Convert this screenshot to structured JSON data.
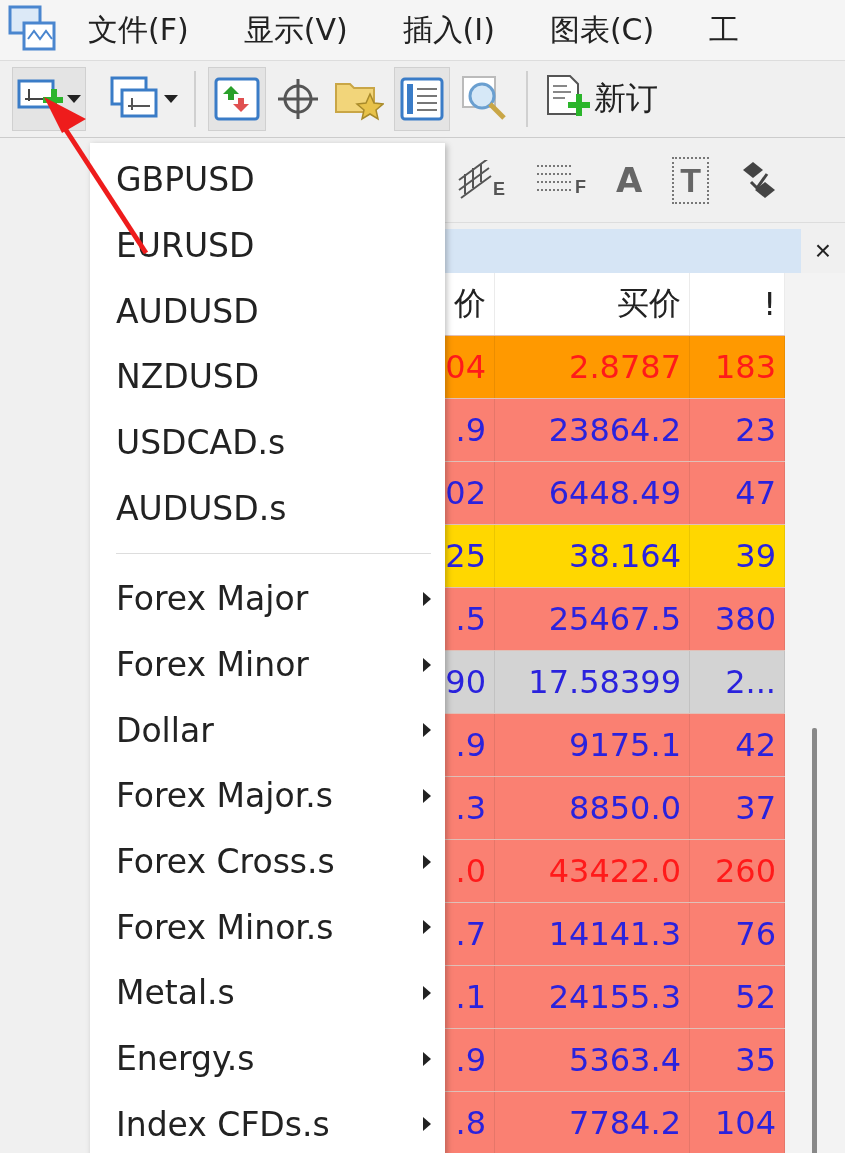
{
  "menu_bar": [
    "文件(F)",
    "显示(V)",
    "插入(I)",
    "图表(C)",
    "工"
  ],
  "toolbar": {
    "new_order_label": "新订"
  },
  "drawing_tools": [
    {
      "kind": "hatch",
      "label": "E"
    },
    {
      "kind": "lines",
      "label": "F"
    },
    {
      "kind": "text",
      "label": "A"
    },
    {
      "kind": "boxed",
      "label": "T"
    },
    {
      "kind": "arrows"
    }
  ],
  "quick_menu": {
    "symbols": [
      "GBPUSD",
      "EURUSD",
      "AUDUSD",
      "NZDUSD",
      "USDCAD.s",
      "AUDUSD.s"
    ],
    "groups": [
      {
        "label": "Forex Major",
        "has_submenu": true
      },
      {
        "label": "Forex Minor",
        "has_submenu": true
      },
      {
        "label": "Dollar",
        "has_submenu": true
      },
      {
        "label": "Forex Major.s",
        "has_submenu": true
      },
      {
        "label": "Forex Cross.s",
        "has_submenu": true
      },
      {
        "label": "Forex Minor.s",
        "has_submenu": true
      },
      {
        "label": "Metal.s",
        "has_submenu": true
      },
      {
        "label": "Energy.s",
        "has_submenu": true
      },
      {
        "label": "Index CFDs.s",
        "has_submenu": true
      }
    ]
  },
  "market_watch": {
    "close": "×",
    "columns": [
      "价",
      "买价",
      "!"
    ],
    "rows": [
      {
        "cells": [
          "04",
          "2.8787",
          "183"
        ],
        "color": "#ff9900",
        "kind": "alert"
      },
      {
        "cells": [
          ".9",
          "23864.2",
          "23"
        ],
        "color": "#fa8072",
        "kind": "normal"
      },
      {
        "cells": [
          "02",
          "6448.49",
          "47"
        ],
        "color": "#fa8072",
        "kind": "normal"
      },
      {
        "cells": [
          "25",
          "38.164",
          "39"
        ],
        "color": "#ffd700",
        "kind": "normal"
      },
      {
        "cells": [
          ".5",
          "25467.5",
          "380"
        ],
        "color": "#fa8072",
        "kind": "normal"
      },
      {
        "cells": [
          "90",
          "17.58399",
          "2..."
        ],
        "color": "#d3d3d3",
        "kind": "normal"
      },
      {
        "cells": [
          ".9",
          "9175.1",
          "42"
        ],
        "color": "#fa8072",
        "kind": "normal"
      },
      {
        "cells": [
          ".3",
          "8850.0",
          "37"
        ],
        "color": "#fa8072",
        "kind": "normal"
      },
      {
        "cells": [
          ".0",
          "43422.0",
          "260"
        ],
        "color": "#fa8072",
        "kind": "alert"
      },
      {
        "cells": [
          ".7",
          "14141.3",
          "76"
        ],
        "color": "#fa8072",
        "kind": "normal"
      },
      {
        "cells": [
          ".1",
          "24155.3",
          "52"
        ],
        "color": "#fa8072",
        "kind": "normal"
      },
      {
        "cells": [
          ".9",
          "5363.4",
          "35"
        ],
        "color": "#fa8072",
        "kind": "normal"
      },
      {
        "cells": [
          ".8",
          "7784.2",
          "104"
        ],
        "color": "#fa8072",
        "kind": "normal"
      }
    ]
  }
}
